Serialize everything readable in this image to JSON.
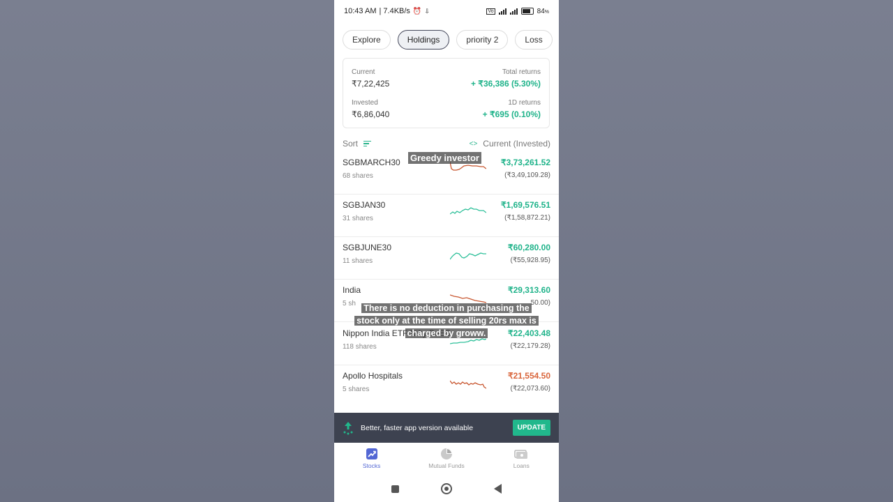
{
  "status_bar": {
    "time": "10:43 AM",
    "net_speed": "| 7.4KB/s",
    "battery": "84",
    "battery_unit": "%"
  },
  "tabs": [
    {
      "label": "Explore",
      "active": false
    },
    {
      "label": "Holdings",
      "active": true
    },
    {
      "label": "priority 2",
      "active": false
    },
    {
      "label": "Loss",
      "active": false
    }
  ],
  "summary": {
    "current_label": "Current",
    "current_value": "₹7,22,425",
    "total_returns_label": "Total returns",
    "total_returns_value": "+ ₹36,386 (5.30%)",
    "invested_label": "Invested",
    "invested_value": "₹6,86,040",
    "oned_returns_label": "1D returns",
    "oned_returns_value": "+ ₹695 (0.10%)"
  },
  "sort_row": {
    "sort_label": "Sort",
    "view_label": "Current (Invested)"
  },
  "holdings": [
    {
      "name": "SGBMARCH30",
      "shares": "68 shares",
      "current": "₹3,73,261.52",
      "invested": "(₹3,49,109.28)",
      "trend": "down"
    },
    {
      "name": "SGBJAN30",
      "shares": "31 shares",
      "current": "₹1,69,576.51",
      "invested": "(₹1,58,872.21)",
      "trend": "up"
    },
    {
      "name": "SGBJUNE30",
      "shares": "11 shares",
      "current": "₹60,280.00",
      "invested": "(₹55,928.95)",
      "trend": "up"
    },
    {
      "name": "India",
      "shares": "5 sh",
      "current": "₹29,313.60",
      "invested": "50.00)",
      "trend": "down"
    },
    {
      "name": "Nippon India ETF Nifty BeES",
      "shares": "118 shares",
      "current": "₹22,403.48",
      "invested": "(₹22,179.28)",
      "trend": "up"
    },
    {
      "name": "Apollo Hospitals",
      "shares": "5 shares",
      "current": "₹21,554.50",
      "invested": "(₹22,073.60)",
      "trend": "down"
    }
  ],
  "colors": {
    "gain": "#1fb38a",
    "loss": "#d9653b",
    "spark_gain": "#2fc09a",
    "spark_loss": "#c8562f"
  },
  "captions": {
    "top": "Greedy investor",
    "middle_line1": "There is no deduction in purchasing the",
    "middle_line2": "stock only at the time of selling 20rs max is",
    "middle_line3": "charged by groww."
  },
  "banner": {
    "text": "Better, faster app version available",
    "button": "UPDATE"
  },
  "bottom_nav": [
    {
      "label": "Stocks",
      "icon": "stocks-icon",
      "active": true
    },
    {
      "label": "Mutual Funds",
      "icon": "pie-chart-icon",
      "active": false
    },
    {
      "label": "Loans",
      "icon": "loans-icon",
      "active": false
    }
  ]
}
